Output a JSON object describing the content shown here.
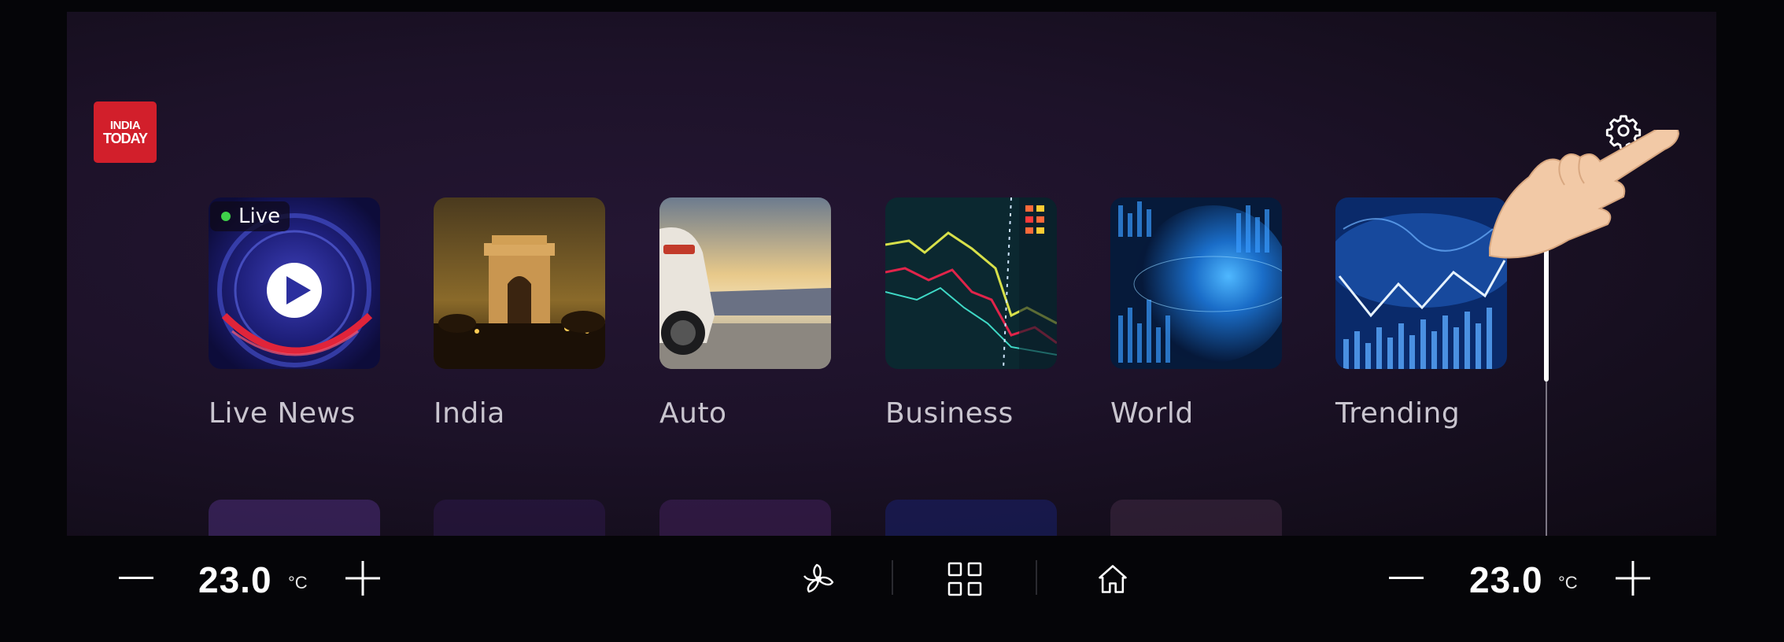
{
  "brand": {
    "line1": "INDIA",
    "line2": "TODAY",
    "color": "#d21f2b"
  },
  "categories": [
    {
      "label": "Live News",
      "badge": "Live",
      "badge_dot_color": "#3fd24a"
    },
    {
      "label": "India"
    },
    {
      "label": "Auto"
    },
    {
      "label": "Business"
    },
    {
      "label": "World"
    },
    {
      "label": "Trending"
    }
  ],
  "settings": {
    "icon": "gear-icon"
  },
  "climate": {
    "left": {
      "temperature": "23.0",
      "unit": "°C"
    },
    "right": {
      "temperature": "23.0",
      "unit": "°C"
    }
  },
  "dock": {
    "icons": [
      "fan-icon",
      "apps-grid-icon",
      "home-icon"
    ]
  },
  "scroll": {
    "position": 0.0
  }
}
